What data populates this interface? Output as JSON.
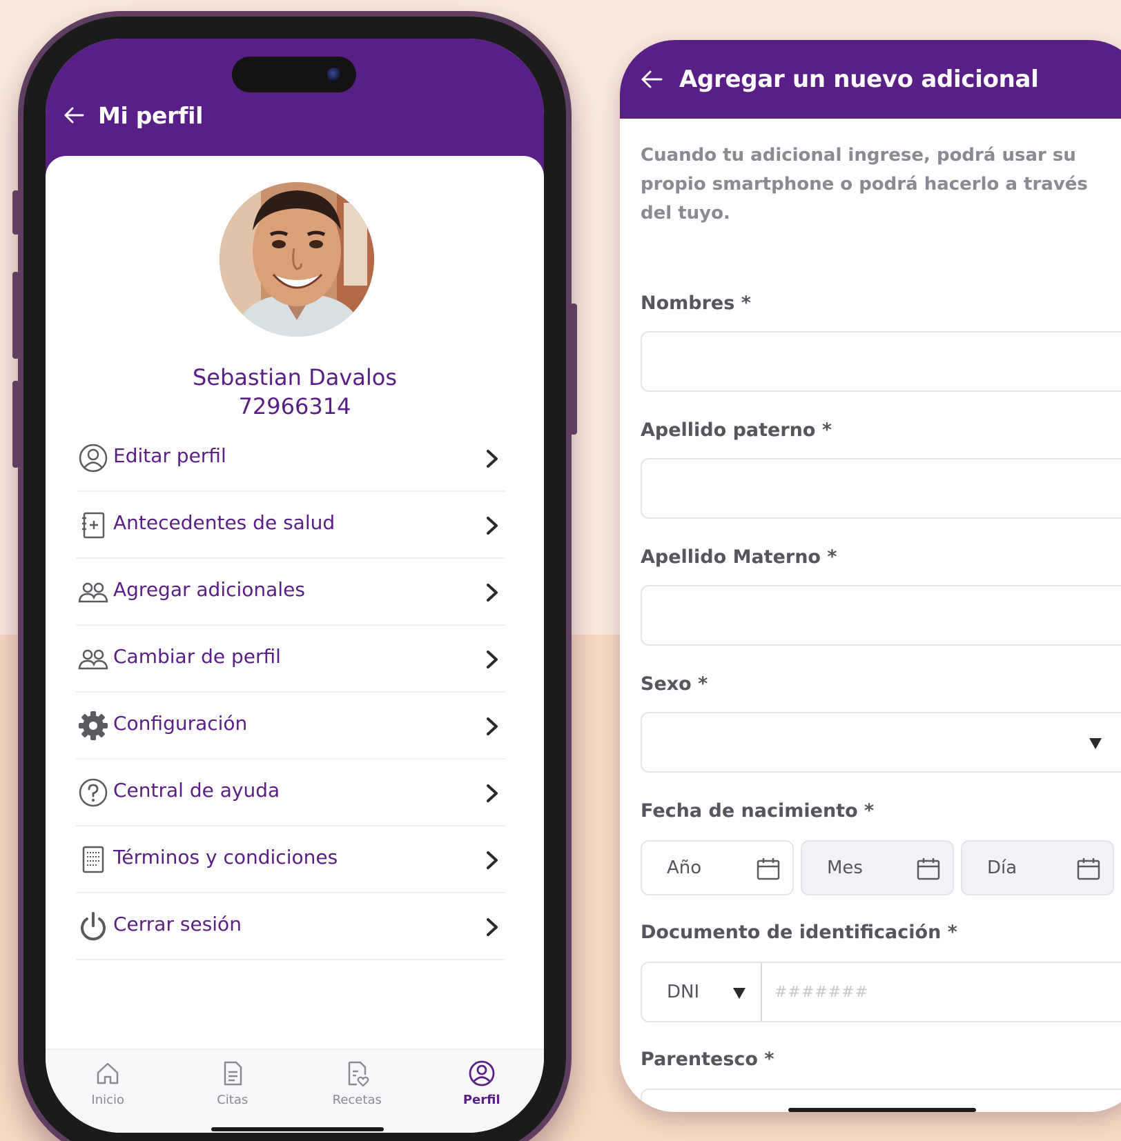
{
  "profile_screen": {
    "header": {
      "title": "Mi perfil",
      "back_icon": "arrow-left-icon"
    },
    "user": {
      "name": "Sebastian Davalos",
      "id": "72966314"
    },
    "menu": [
      {
        "label": "Editar perfil",
        "icon": "user-circle-icon"
      },
      {
        "label": "Antecedentes de salud",
        "icon": "medical-record-icon"
      },
      {
        "label": "Agregar adicionales",
        "icon": "users-icon"
      },
      {
        "label": "Cambiar de perfil",
        "icon": "users-icon"
      },
      {
        "label": "Configuración",
        "icon": "gear-icon"
      },
      {
        "label": "Central de ayuda",
        "icon": "help-circle-icon"
      },
      {
        "label": "Términos y condiciones",
        "icon": "document-list-icon"
      },
      {
        "label": "Cerrar sesión",
        "icon": "power-icon"
      }
    ],
    "tabs": [
      {
        "label": "Inicio",
        "icon": "home-icon",
        "active": false
      },
      {
        "label": "Citas",
        "icon": "document-icon",
        "active": false
      },
      {
        "label": "Recetas",
        "icon": "prescription-icon",
        "active": false
      },
      {
        "label": "Perfil",
        "icon": "user-circle-icon",
        "active": true
      }
    ]
  },
  "add_screen": {
    "header": {
      "title": "Agregar un nuevo adicional",
      "back_icon": "arrow-left-icon"
    },
    "intro": "Cuando tu adicional ingrese, podrá usar su propio smartphone o podrá hacerlo a través del tuyo.",
    "fields": {
      "nombres": {
        "label": "Nombres *",
        "value": ""
      },
      "apellido_paterno": {
        "label": "Apellido paterno *",
        "value": ""
      },
      "apellido_materno": {
        "label": "Apellido Materno *",
        "value": ""
      },
      "sexo": {
        "label": "Sexo *",
        "value": ""
      },
      "fecha": {
        "label": "Fecha de nacimiento *",
        "year": "Año",
        "month": "Mes",
        "day": "Día"
      },
      "documento": {
        "label": "Documento de identificación *",
        "type": "DNI",
        "placeholder": "#######"
      },
      "parentesco": {
        "label": "Parentesco *",
        "value": ""
      }
    }
  },
  "colors": {
    "brand": "#5a1e87",
    "label": "#55555e",
    "muted": "#8a8a93"
  }
}
